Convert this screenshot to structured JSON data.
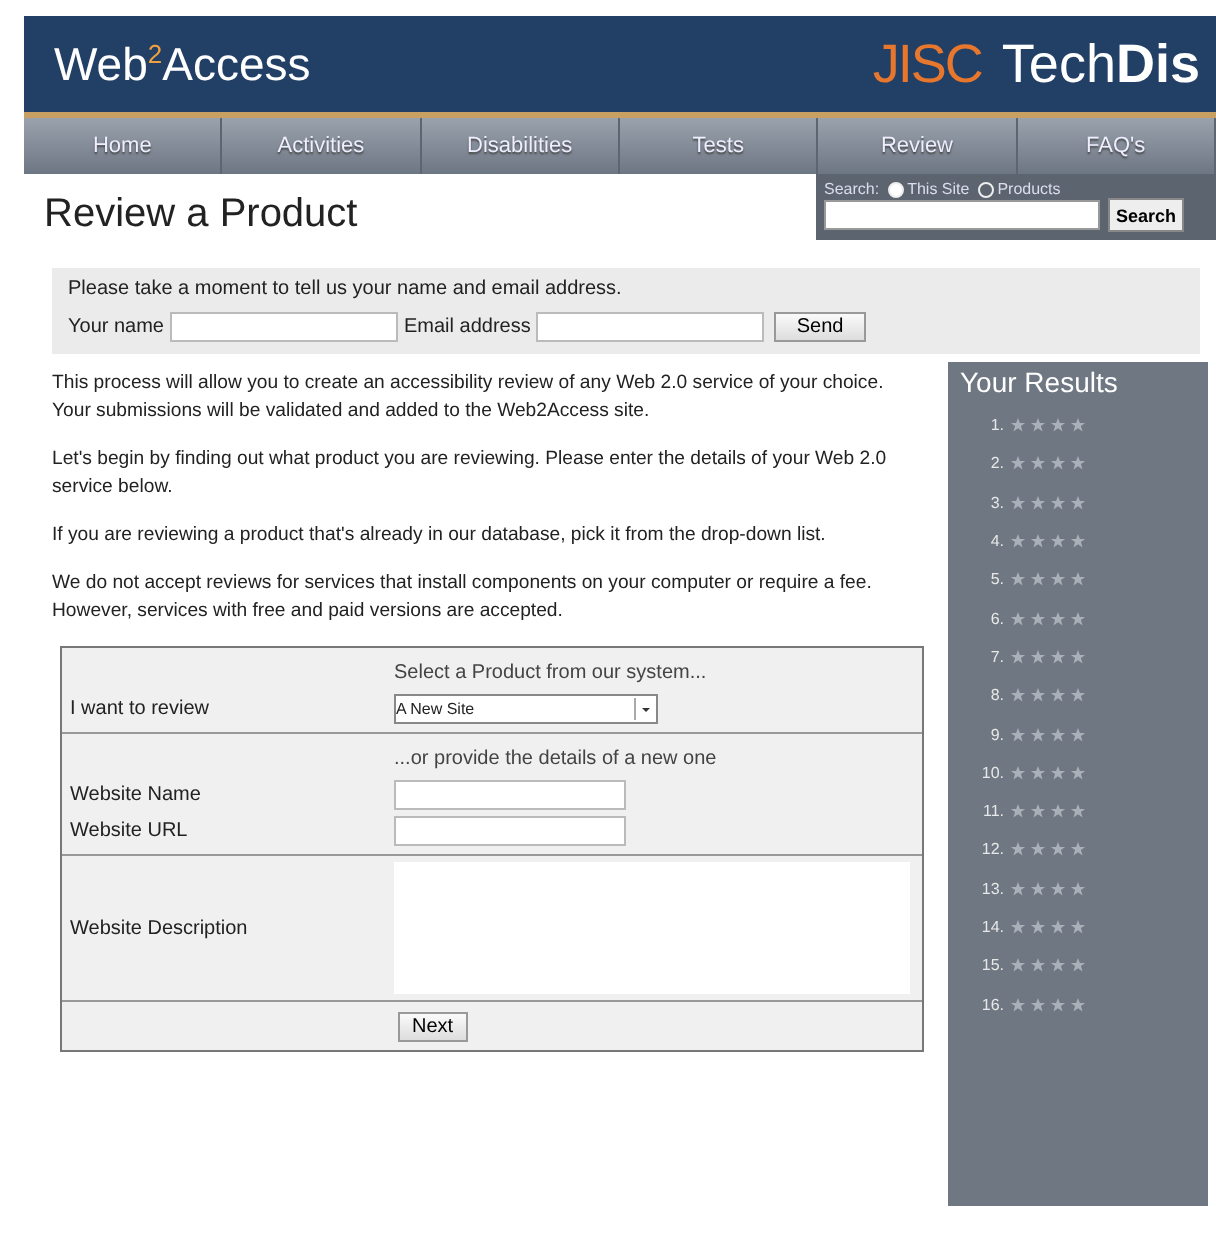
{
  "header": {
    "logo": "Web$^{2}$Access",
    "brand_org": "JISC",
    "brand_name": "Tech**Dis**"
  },
  "nav": [
    "Home",
    "Activities",
    "Disabilities",
    "Tests",
    "Review",
    "FAQ's"
  ],
  "page_title": "Review a Product",
  "search": {
    "label": "Search:",
    "options": [
      {
        "label": "This Site",
        "selected": true
      },
      {
        "label": "Products",
        "selected": false
      }
    ],
    "button": "Search"
  },
  "contact": {
    "intro": "Please take a moment to tell us your name and email address.",
    "name_label": "Your name",
    "email_label": "Email address",
    "button": "Send"
  },
  "paragraphs": [
    "This process will allow you to create an accessibility review of any Web 2.0 service of your choice. Your submissions will be validated and added to the Web2Access site.",
    "Let's begin by finding out what product you are reviewing. Please enter the details of your Web 2.0 service below.",
    "If you are reviewing a product that's already in our database, pick it from the drop-down list.",
    "We do not accept reviews for services that install components on your computer or require a fee. However, services with free and paid versions are accepted."
  ],
  "form": {
    "select_hint": "Select a Product from our system...",
    "review_label": "I want to review",
    "review_value": "A New Site",
    "new_hint": "...or provide the details of a new one",
    "name_label": "Website Name",
    "url_label": "Website URL",
    "description_label": "Website Description",
    "button": "Next"
  },
  "results": {
    "title": "Your Results",
    "items": [
      {
        "number": "1.",
        "stars": 0
      },
      {
        "number": "2.",
        "stars": 0
      },
      {
        "number": "3.",
        "stars": 0
      },
      {
        "number": "4.",
        "stars": 0
      },
      {
        "number": "5.",
        "stars": 0
      },
      {
        "number": "6.",
        "stars": 0
      },
      {
        "number": "7.",
        "stars": 0
      },
      {
        "number": "8.",
        "stars": 0
      },
      {
        "number": "9.",
        "stars": 0
      },
      {
        "number": "10.",
        "stars": 0
      },
      {
        "number": "11.",
        "stars": 0
      },
      {
        "number": "12.",
        "stars": 0
      },
      {
        "number": "13.",
        "stars": 0
      },
      {
        "number": "14.",
        "stars": 0
      },
      {
        "number": "15.",
        "stars": 0
      },
      {
        "number": "16.",
        "stars": 0
      }
    ]
  }
}
